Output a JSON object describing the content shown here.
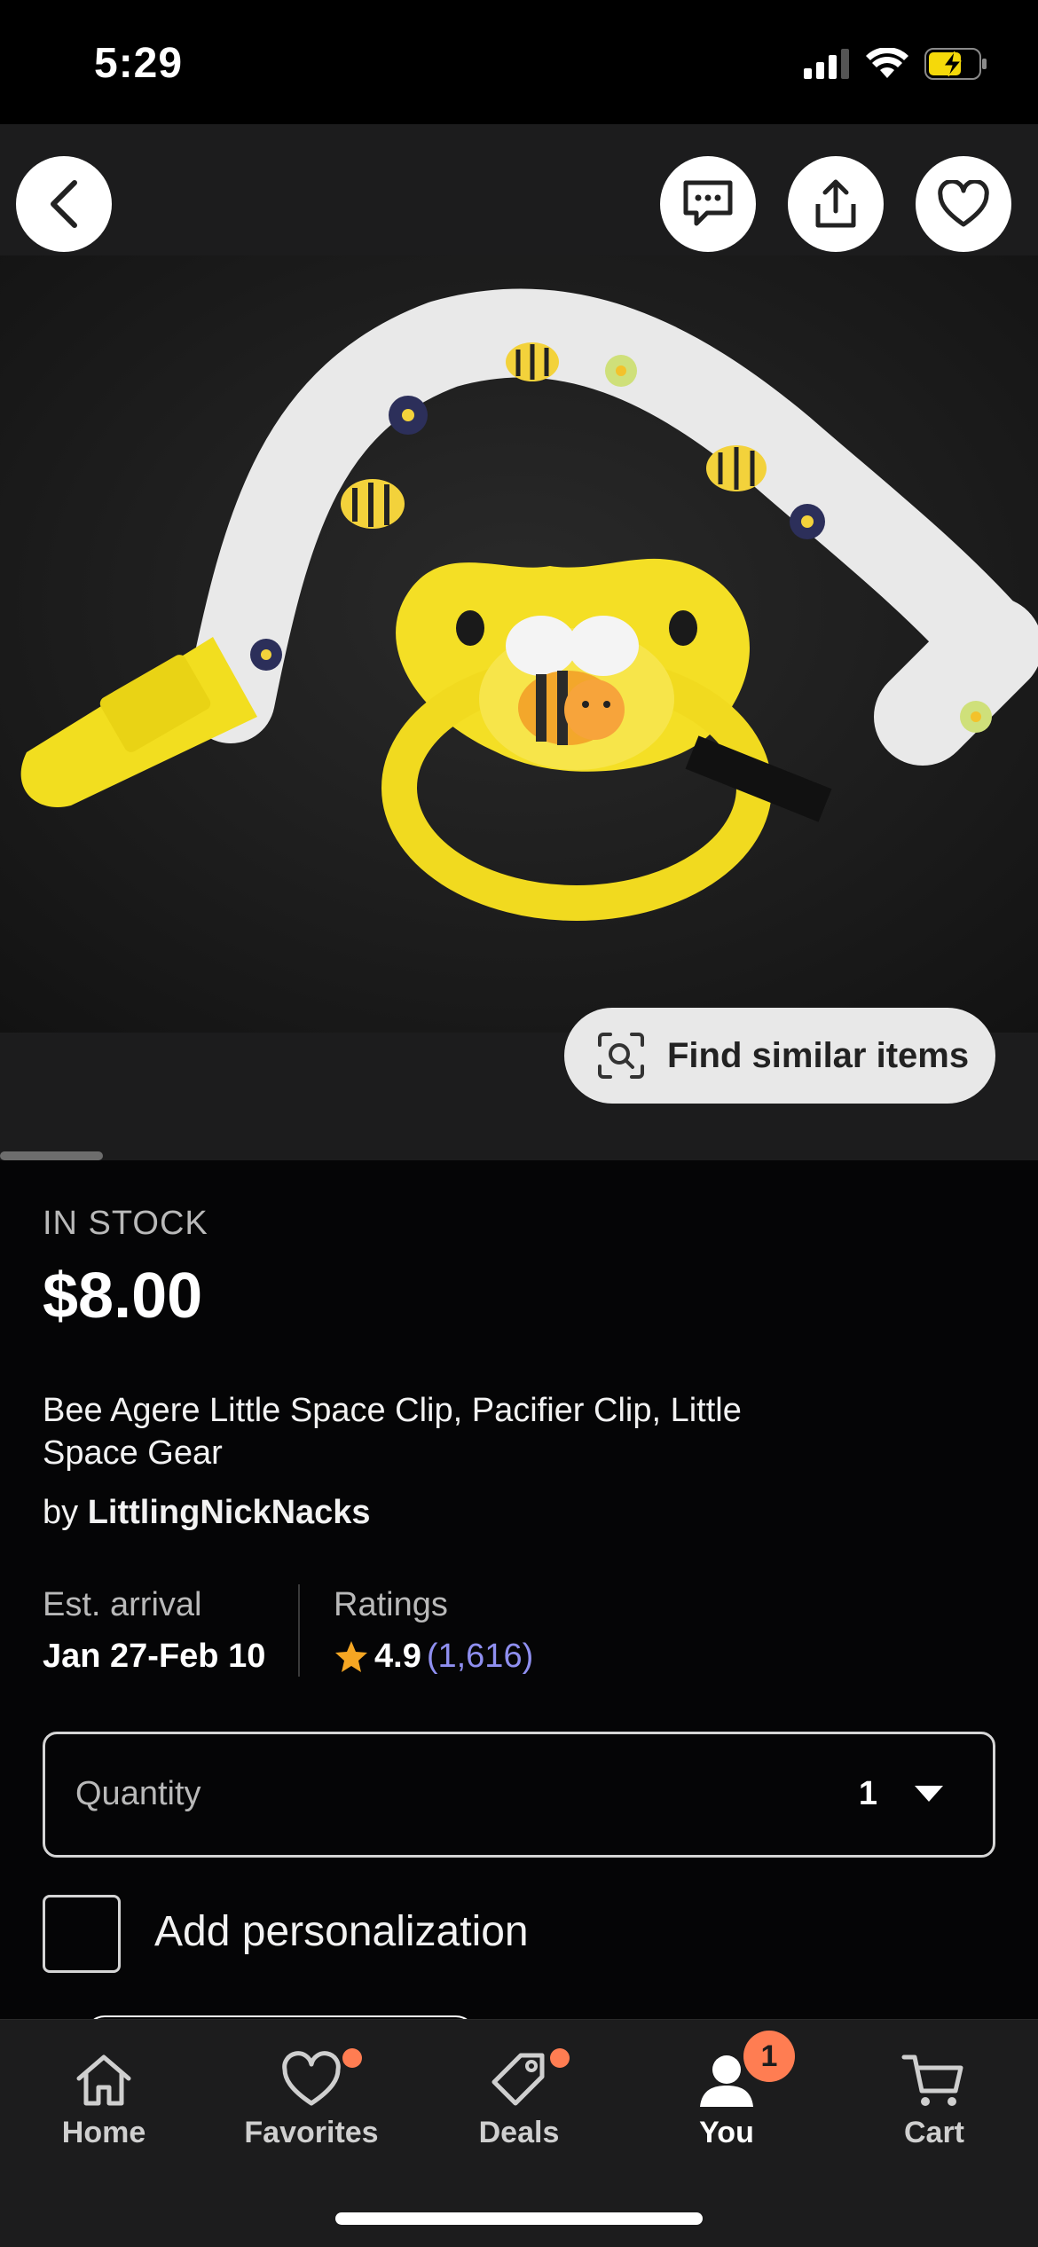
{
  "status_bar": {
    "time": "5:29"
  },
  "top_bar": {
    "back_icon": "chevron-left-icon",
    "actions": [
      "message-icon",
      "share-icon",
      "heart-icon"
    ]
  },
  "image": {
    "find_similar_label": "Find similar items",
    "find_similar_icon": "visual-search-icon"
  },
  "product": {
    "stock": "IN STOCK",
    "price": "$8.00",
    "title": "Bee Agere Little Space Clip, Pacifier Clip, Little Space Gear",
    "by_prefix": "by",
    "shop": "LittlingNickNacks"
  },
  "info": {
    "arrival_label": "Est. arrival",
    "arrival_value": "Jan 27-Feb 10",
    "ratings_label": "Ratings",
    "rating": "4.9",
    "rating_count": "(1,616)"
  },
  "quantity": {
    "label": "Quantity",
    "value": "1"
  },
  "personalization": {
    "label": "Add personalization"
  },
  "tabs": [
    {
      "label": "Home",
      "icon": "home-icon"
    },
    {
      "label": "Favorites",
      "icon": "heart-icon"
    },
    {
      "label": "Deals",
      "icon": "tag-icon"
    },
    {
      "label": "You",
      "icon": "person-icon",
      "badge": "1"
    },
    {
      "label": "Cart",
      "icon": "cart-icon"
    }
  ],
  "colors": {
    "accent": "#ff7d52",
    "rating_link": "#8f8ff0",
    "star": "#f5a623"
  }
}
